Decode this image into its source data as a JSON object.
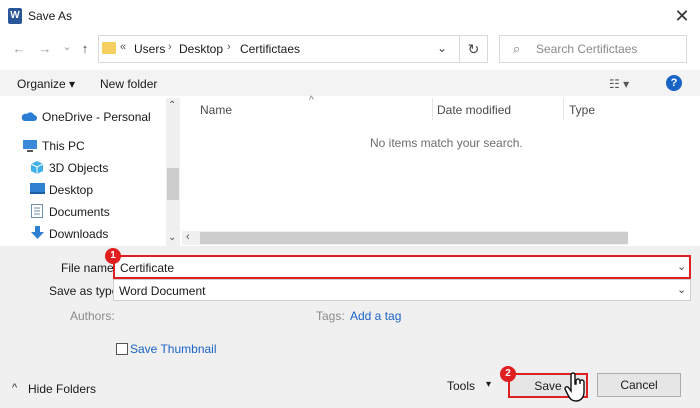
{
  "window": {
    "title": "Save As",
    "app_icon": "W"
  },
  "nav": {
    "back": "←",
    "forward": "→",
    "recent": "⌄",
    "up": "↑",
    "breadcrumb": [
      "Users",
      "Desktop",
      "Certifictaes"
    ],
    "chevron": "«",
    "separator": "›",
    "refresh": "↻",
    "search_placeholder": "Search Certifictaes"
  },
  "toolbar": {
    "organize": "Organize ▾",
    "new_folder": "New folder",
    "view": "☷ ▾",
    "help": "?"
  },
  "sidebar": {
    "items": [
      {
        "label": "OneDrive - Personal",
        "icon": "cloud-icon",
        "color": "#2b7cd3"
      },
      {
        "label": "This PC",
        "icon": "computer-icon",
        "color": "#3b8ad9"
      },
      {
        "label": "3D Objects",
        "icon": "cube-icon",
        "color": "#3fb0e8"
      },
      {
        "label": "Desktop",
        "icon": "desktop-icon",
        "color": "#2f80d0"
      },
      {
        "label": "Documents",
        "icon": "document-icon",
        "color": "#6f8fb0"
      },
      {
        "label": "Downloads",
        "icon": "download-icon",
        "color": "#2f80d0"
      }
    ]
  },
  "file_list": {
    "columns": [
      "Name",
      "Date modified",
      "Type"
    ],
    "sort_arrow": "^",
    "empty_message": "No items match your search."
  },
  "form": {
    "file_name_label": "File name:",
    "file_name_value": "Certificate",
    "save_as_type_label": "Save as type:",
    "save_as_type_value": "Word Document",
    "authors_label": "Authors:",
    "tags_label": "Tags:",
    "add_tag": "Add a tag",
    "save_thumbnail": "Save Thumbnail",
    "badge1": "1",
    "badge2": "2"
  },
  "footer": {
    "hide_folders": "Hide Folders",
    "hide_arrow": "^",
    "tools": "Tools",
    "tools_arrow": "▾",
    "save": "Save",
    "cancel": "Cancel"
  },
  "colors": {
    "highlight": "#e02020",
    "accent": "#1a63c6"
  }
}
